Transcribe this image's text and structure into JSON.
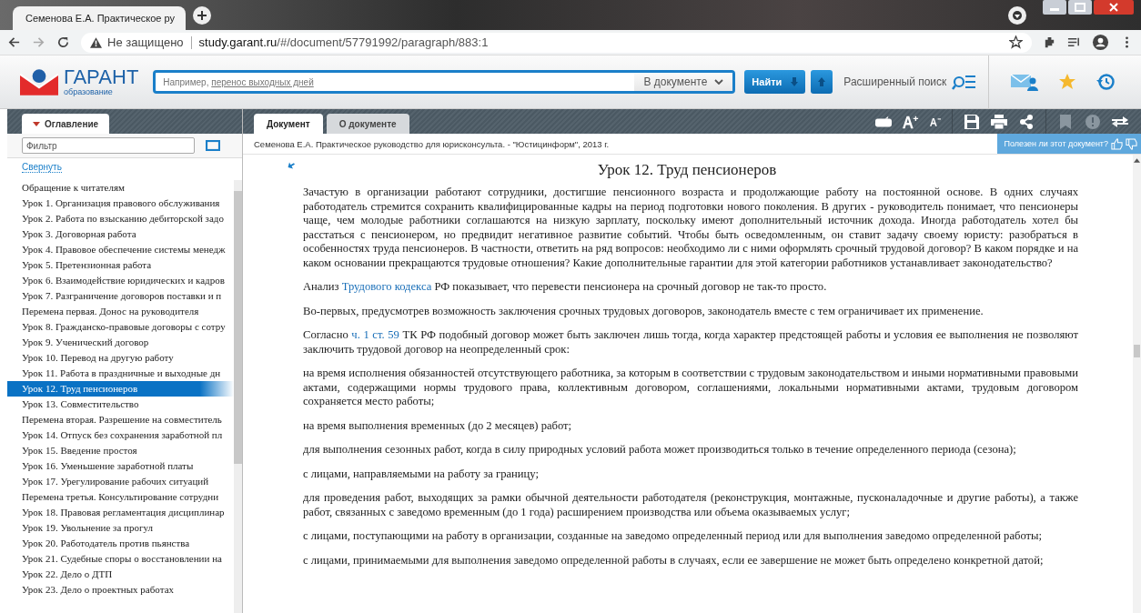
{
  "browser": {
    "tab_title": "Семенова Е.А. Практическое ру",
    "security": "Не защищено",
    "url_host": "study.garant.ru",
    "url_path": "/#/document/57791992/paragraph/883:1"
  },
  "header": {
    "logo_title": "ГАРАНТ",
    "logo_subtitle": "образование",
    "search_hint": "Например, ",
    "search_hint_link": "перенос выходных дней",
    "scope": "В документе",
    "find_button": "Найти",
    "advanced_search": "Расширенный поиск"
  },
  "sidebar": {
    "tab": "Оглавление",
    "filter_placeholder": "Фильтр",
    "collapse": "Свернуть",
    "items": [
      {
        "label": "Обращение к читателям",
        "selected": false
      },
      {
        "label": "Урок 1. Организация правового обслуживания",
        "selected": false
      },
      {
        "label": "Урок 2. Работа по взысканию дебиторской задо",
        "selected": false
      },
      {
        "label": "Урок 3. Договорная работа",
        "selected": false
      },
      {
        "label": "Урок 4. Правовое обеспечение системы менедж",
        "selected": false
      },
      {
        "label": "Урок 5. Претензионная работа",
        "selected": false
      },
      {
        "label": "Урок 6. Взаимодействие юридических и кадров",
        "selected": false
      },
      {
        "label": "Урок 7. Разграничение договоров поставки и п",
        "selected": false
      },
      {
        "label": "Перемена первая. Донос на руководителя",
        "selected": false
      },
      {
        "label": "Урок 8. Гражданско-правовые договоры с сотру",
        "selected": false
      },
      {
        "label": "Урок 9. Ученический договор",
        "selected": false
      },
      {
        "label": "Урок 10. Перевод на другую работу",
        "selected": false
      },
      {
        "label": "Урок 11. Работа в праздничные и выходные дн",
        "selected": false
      },
      {
        "label": "Урок 12. Труд пенсионеров",
        "selected": true
      },
      {
        "label": "Урок 13. Совместительство",
        "selected": false
      },
      {
        "label": "Перемена вторая. Разрешение на совместитель",
        "selected": false
      },
      {
        "label": "Урок 14. Отпуск без сохранения заработной пл",
        "selected": false
      },
      {
        "label": "Урок 15. Введение простоя",
        "selected": false
      },
      {
        "label": "Урок 16. Уменьшение заработной платы",
        "selected": false
      },
      {
        "label": "Урок 17. Урегулирование рабочих ситуаций",
        "selected": false
      },
      {
        "label": "Перемена третья. Консультирование сотрудни",
        "selected": false
      },
      {
        "label": "Урок 18. Правовая регламентация дисциплинар",
        "selected": false
      },
      {
        "label": "Урок 19. Увольнение за прогул",
        "selected": false
      },
      {
        "label": "Урок 20. Работодатель против пьянства",
        "selected": false
      },
      {
        "label": "Урок 21. Судебные споры о восстановлении на",
        "selected": false
      },
      {
        "label": "Урок 22. Дело о ДТП",
        "selected": false
      },
      {
        "label": "Урок 23. Дело о проектных работах",
        "selected": false
      }
    ]
  },
  "doc_tabs": [
    {
      "label": "Документ",
      "selected": true
    },
    {
      "label": "О документе",
      "selected": false
    }
  ],
  "doc_source": "Семенова Е.А. Практическое руководство для юрисконсульта. - \"Юстицинформ\", 2013 г.",
  "feedback": "Полезен ли этот документ?",
  "document": {
    "title": "Урок 12. Труд пенсионеров",
    "paragraphs": [
      [
        {
          "kind": "text",
          "text": "Зачастую в организации работают сотрудники, достигшие пенсионного возраста и продолжающие работу на постоянной основе. В одних случаях работодатель стремится сохранить квалифицированные кадры на период подготовки нового поколения. В других - руководитель понимает, что пенсионеры чаще, чем молодые работники соглашаются на низкую зарплату, поскольку имеют дополнительный источник дохода. Иногда работодатель хотел бы расстаться с пенсионером, но предвидит негативное развитие событий. Чтобы быть осведомленным, он ставит задачу своему юристу: разобраться в особенностях труда пенсионеров. В частности, ответить на ряд вопросов: необходимо ли с ними оформлять срочный трудовой договор? В каком порядке и на каком основании прекращаются трудовые отношения? Какие дополнительные гарантии для этой категории работников устанавливает законодательство?"
        }
      ],
      [
        {
          "kind": "text",
          "text": "Анализ "
        },
        {
          "kind": "link",
          "text": "Трудового кодекса"
        },
        {
          "kind": "text",
          "text": " РФ показывает, что перевести пенсионера на срочный договор не так-то просто."
        }
      ],
      [
        {
          "kind": "text",
          "text": "Во-первых, предусмотрев возможность заключения срочных трудовых договоров, законодатель вместе с тем ограничивает их применение."
        }
      ],
      [
        {
          "kind": "text",
          "text": "Согласно "
        },
        {
          "kind": "link",
          "text": "ч. 1 ст. 59"
        },
        {
          "kind": "text",
          "text": " ТК РФ подобный договор может быть заключен лишь тогда, когда характер предстоящей работы и условия ее выполнения не позволяют заключить трудовой договор на неопределенный срок:"
        }
      ],
      [
        {
          "kind": "text",
          "text": "на время исполнения обязанностей отсутствующего работника, за которым в соответствии с трудовым законодательством и иными нормативными правовыми актами, содержащими нормы трудового права, коллективным договором, соглашениями, локальными нормативными актами, трудовым договором сохраняется место работы;"
        }
      ],
      [
        {
          "kind": "text",
          "text": "на время выполнения временных (до 2 месяцев) работ;"
        }
      ],
      [
        {
          "kind": "text",
          "text": "для выполнения сезонных работ, когда в силу природных условий работа может производиться только в течение определенного периода (сезона);"
        }
      ],
      [
        {
          "kind": "text",
          "text": "с лицами, направляемыми на работу за границу;"
        }
      ],
      [
        {
          "kind": "text",
          "text": "для проведения работ, выходящих за рамки обычной деятельности работодателя (реконструкция, монтажные, пусконаладочные и другие работы), а также работ, связанных с заведомо временным (до 1 года) расширением производства или объема оказываемых услуг;"
        }
      ],
      [
        {
          "kind": "text",
          "text": "с лицами, поступающими на работу в организации, созданные на заведомо определенный период или для выполнения заведомо определенной работы;"
        }
      ],
      [
        {
          "kind": "text",
          "text": "с лицами, принимаемыми для выполнения заведомо определенной работы в случаях, если ее завершение не может быть определено конкретной датой;"
        }
      ]
    ]
  }
}
